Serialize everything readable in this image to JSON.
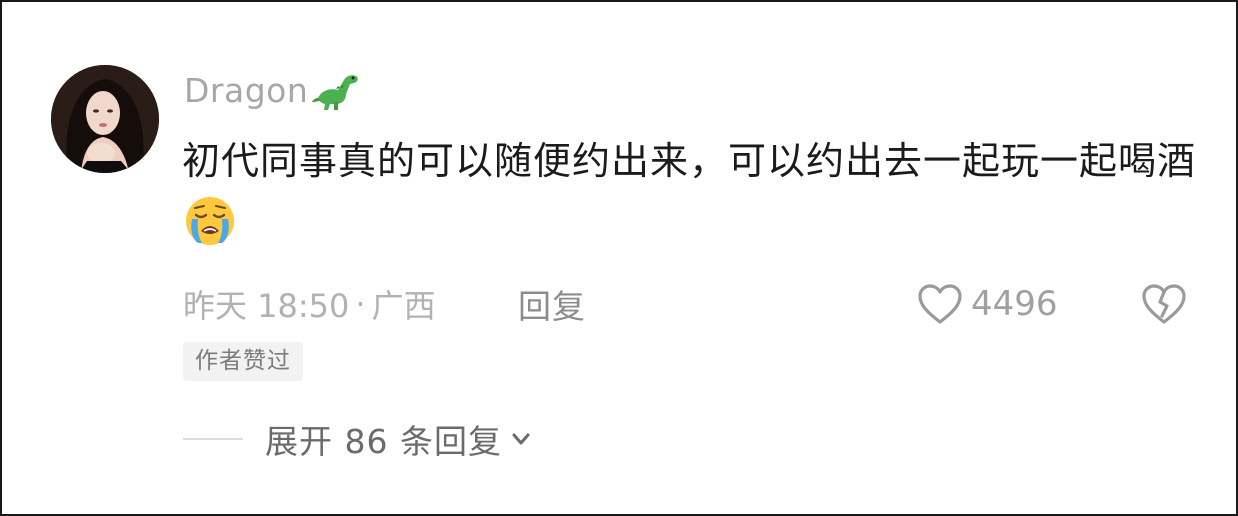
{
  "comment": {
    "username": "Dragon",
    "username_emoji": "dinosaur-icon",
    "text": "初代同事真的可以随便约出来，可以约出去一起玩一起喝酒",
    "text_emoji": "loudly-crying-face-icon",
    "timestamp": "昨天 18:50",
    "separator": "·",
    "location": "广西",
    "reply_label": "回复",
    "like_count": "4496",
    "author_badge": "作者赞过",
    "expand_label": "展开 86 条回复"
  },
  "colors": {
    "background": "#ffffff",
    "username": "#a7a7a7",
    "text": "#1b1b1b",
    "meta": "#b2b2b2",
    "badge_bg": "#f2f2f2",
    "dino_green": "#4caf50",
    "emoji_yellow": "#ffc83d",
    "tear_blue": "#4aa8e8"
  }
}
